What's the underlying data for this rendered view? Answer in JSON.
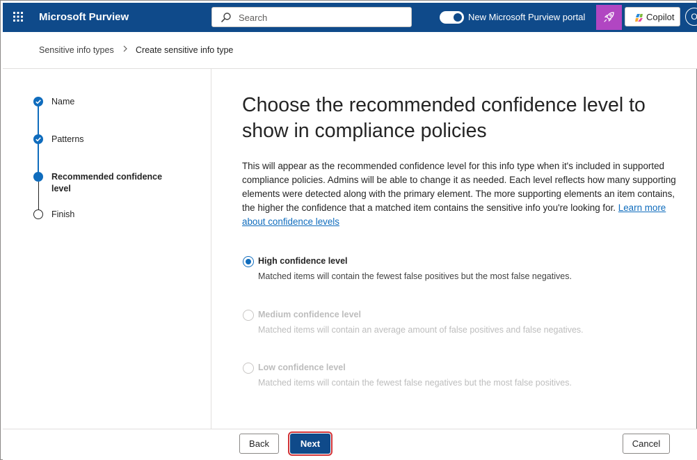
{
  "topbar": {
    "app_title": "Microsoft Purview",
    "search_placeholder": "Search",
    "portal_toggle_label": "New Microsoft Purview portal",
    "portal_toggle_on": true,
    "copilot_label": "Copilot",
    "avatar_initial": "O",
    "icons": {
      "waffle": "app-launcher-icon",
      "search": "search-icon",
      "rocket": "rocket-icon",
      "copilot": "copilot-icon"
    },
    "colors": {
      "bar": "#0f4a8a",
      "rocket_button": "#b146c2"
    }
  },
  "breadcrumb": {
    "parent": "Sensitive info types",
    "separator": ">",
    "current": "Create sensitive info type"
  },
  "stepper": {
    "steps": [
      {
        "label": "Name",
        "state": "completed"
      },
      {
        "label": "Patterns",
        "state": "completed"
      },
      {
        "label": "Recommended confidence level",
        "state": "current"
      },
      {
        "label": "Finish",
        "state": "pending"
      }
    ]
  },
  "main": {
    "heading": "Choose the recommended confidence level to show in compliance policies",
    "description": "This will appear as the recommended confidence level for this info type when it's included in supported compliance policies. Admins will be able to change it as needed. Each level reflects how many supporting elements were detected along with the primary element. The more supporting elements an item contains, the higher the confidence that a matched item contains the sensitive info you're looking for.",
    "learn_more": "Learn more about confidence levels",
    "options": [
      {
        "title": "High confidence level",
        "description": "Matched items will contain the fewest false positives but the most false negatives.",
        "selected": true,
        "disabled": false
      },
      {
        "title": "Medium confidence level",
        "description": "Matched items will contain an average amount of false positives and false negatives.",
        "selected": false,
        "disabled": true
      },
      {
        "title": "Low confidence level",
        "description": "Matched items will contain the fewest false negatives but the most false positives.",
        "selected": false,
        "disabled": true
      }
    ]
  },
  "footer": {
    "back_label": "Back",
    "next_label": "Next",
    "cancel_label": "Cancel"
  }
}
